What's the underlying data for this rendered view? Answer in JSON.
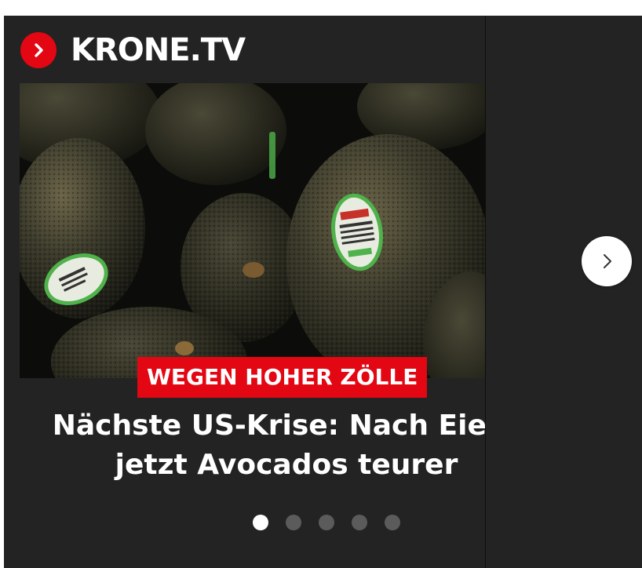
{
  "brand": {
    "name": "KRONE.TV",
    "logo_icon": "chevron-right-icon",
    "accent_color": "#e30613"
  },
  "carousel": {
    "active_index": 0,
    "slides": [
      {
        "kicker": "WEGEN HOHER ZÖLLE",
        "title_line_1": "Nächste US-Krise: Nach Eiern",
        "title_line_2": "jetzt Avocados teurer"
      }
    ],
    "next_icon": "chevron-right-icon",
    "dot_count": 5
  }
}
